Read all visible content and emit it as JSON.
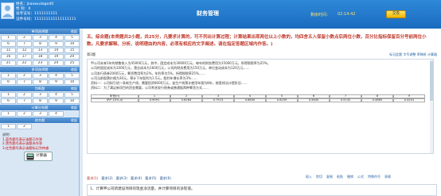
{
  "header": {
    "user": {
      "name_label": "姓名：",
      "name_value": "jkaowudage40",
      "gender_label": "性 别：",
      "gender_value": "X",
      "ticket_label": "准考证号：",
      "ticket_value": "1111111111",
      "id_label": "证件号码：",
      "id_value": "111111111111111111"
    },
    "exam_title": "财务管理",
    "timer_label": "剩余时间：",
    "timer_value": "02:14:42",
    "submit_label": "交卷"
  },
  "sidebar": {
    "sections": [
      {
        "title": "单项选择题",
        "toggle": "收起",
        "items": [
          "1",
          "2",
          "3",
          "4",
          "5",
          "6",
          "7",
          "8",
          "9",
          "10",
          "11",
          "12",
          "13",
          "14",
          "15",
          "16",
          "17",
          "18",
          "19",
          "20",
          "21",
          "22",
          "23",
          "24",
          "25"
        ]
      },
      {
        "title": "多项选择题",
        "toggle": "收起",
        "items": [
          "1",
          "2",
          "3",
          "4",
          "5",
          "6",
          "7",
          "8",
          "9",
          "10"
        ]
      },
      {
        "title": "判断题",
        "toggle": "收起",
        "items": [
          "1",
          "2",
          "3",
          "4",
          "5",
          "6",
          "7",
          "8",
          "9",
          "10"
        ]
      },
      {
        "title": "计算分析题",
        "toggle": "收起",
        "items": [
          "1",
          "2",
          "3",
          "4"
        ]
      },
      {
        "title": "综合题",
        "toggle": "收起",
        "items": [
          "1",
          "2"
        ]
      }
    ],
    "notes": {
      "title": "说明：",
      "line1": "1.蓝色题号表示该题已作答",
      "line2": "2.黑色题号表示该题未作答",
      "line3": "3.红色题号表示该题标记为待查"
    },
    "calculator_label": "计算器"
  },
  "main": {
    "question_title": "五、综合题(本类题共2小题，共25分，凡要求计算的，可不列出计算过程；计算结果出现两位以上小数的，均四舍五入保留小数点后两位小数，百分比指标保留百分号前两位小数。凡要求解释、分析、说明理由的内容，必须有相应的文字阐述。请在指定答题区域内作答。)",
    "zoom_label": "第2题",
    "tools": [
      "标记此题",
      "字号调整",
      "草稿纸",
      "计算器"
    ],
    "case_lines": [
      "甲公司未来1年的销售收入为45000万元，其中，固定成本为30000万元，每年的财务费用为15000万元，所得税税率为25%。",
      "公司的固定成本为1000万元，营业成本为1600万元，公司的财务费用为150万元，单位变动成本为120万元……",
      "公司发行债券2000万元，筹资费用率为2%，年利率为5%，所得税税率25%……",
      "公司当前股票价格为30元，预计下年股利为1.5元，股利年增长率为3%……",
      "资料一：公司拟引进一条新生产线，需要投资8000万元，该生产线预计使用年限为8年，按直线法计提折旧……",
      "资料二：为了满足新项目的资金需要，公司考虑发行债券或普通股两种筹资方式……"
    ],
    "table_header": [
      "年份(n)",
      "1",
      "2",
      "3",
      "4",
      "5",
      "6",
      "7",
      "8",
      "9"
    ],
    "table_row": [
      "(P/F,10%,n)",
      "0.9091",
      "0.8264",
      "0.7513",
      "0.6830",
      "0.6209",
      "0.5645",
      "0.5132",
      "0.4665",
      "0.4241"
    ],
    "toolbar": [
      "插入",
      "剪切",
      "复制",
      "粘贴",
      "撤销",
      "公式",
      "特殊符号",
      "表格"
    ],
    "answer_tabs": [
      "要求(1)",
      "要求(2)",
      "要求(3)",
      "要求(4)",
      "要求(5)",
      "要求(6)"
    ],
    "answer_prompt": "1、计算甲公司新建设项目的现金净流量，并计算项目的净现值。"
  }
}
